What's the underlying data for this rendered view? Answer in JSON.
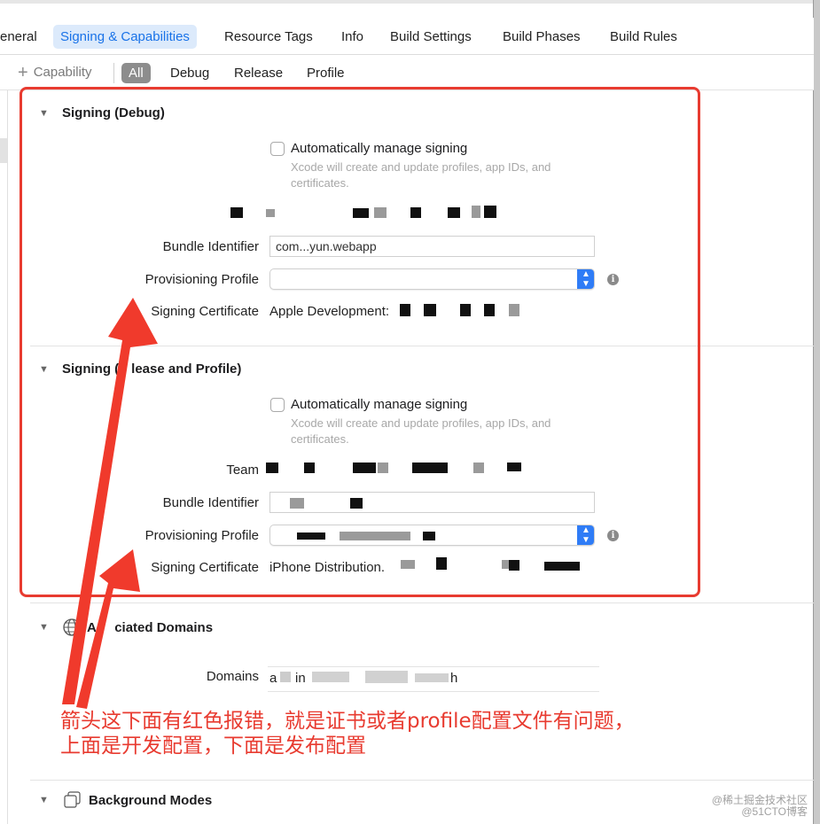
{
  "tabs": [
    {
      "label": "eneral"
    },
    {
      "label": "Signing & Capabilities"
    },
    {
      "label": "Resource Tags"
    },
    {
      "label": "Info"
    },
    {
      "label": "Build Settings"
    },
    {
      "label": "Build Phases"
    },
    {
      "label": "Build Rules"
    }
  ],
  "capability_bar": {
    "add_label": "Capability",
    "filters": [
      "All",
      "Debug",
      "Release",
      "Profile"
    ]
  },
  "signing_debug": {
    "title": "Signing (Debug)",
    "auto_manage_label": "Automatically manage signing",
    "auto_manage_hint": "Xcode will create and update profiles, app IDs, and certificates.",
    "bundle_label": "Bundle Identifier",
    "bundle_value": "com...yun.webapp",
    "profile_label": "Provisioning Profile",
    "cert_label": "Signing Certificate",
    "cert_value": "Apple Development:"
  },
  "signing_release": {
    "title_prefix": "Signing (",
    "title_suffix": "lease and Profile)",
    "auto_manage_label": "Automatically manage signing",
    "auto_manage_hint": "Xcode will create and update profiles, app IDs, and certificates.",
    "team_label": "Team",
    "bundle_label": "Bundle Identifier",
    "profile_label": "Provisioning Profile",
    "cert_label": "Signing Certificate",
    "cert_value": "iPhone Distribution."
  },
  "associated_domains": {
    "title_prefix": "As",
    "title_suffix": "ciated Domains",
    "domains_label": "Domains",
    "domains_value_a": "a",
    "domains_value_b": "in",
    "domains_value_c": "h"
  },
  "background_modes": {
    "title": "Background Modes"
  },
  "annotation": {
    "line1": "箭头这下面有红色报错，就是证书或者profile配置文件有问题，",
    "line2": "上面是开发配置，下面是发布配置"
  },
  "watermark": {
    "line1": "@稀土掘金技术社区",
    "line2": "@51CTO博客"
  },
  "colors": {
    "accent": "#1a73e8",
    "annotation_red": "#e83b30",
    "popup_blue": "#2f7cf6"
  }
}
